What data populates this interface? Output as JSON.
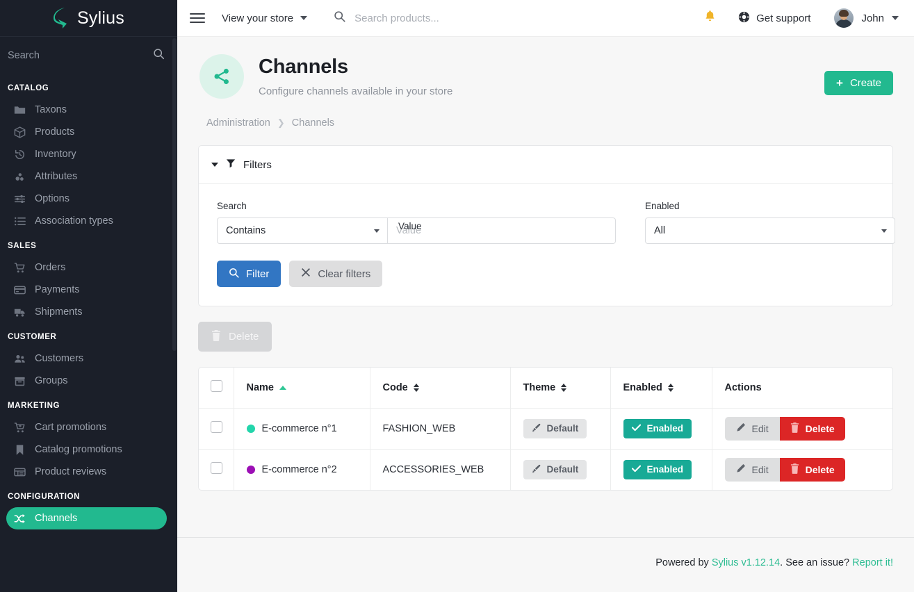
{
  "brand": {
    "name": "Sylius",
    "logo_icon": "sylius-logo-icon"
  },
  "sidebar": {
    "search_placeholder": "Search",
    "search_icon": "search-icon",
    "sections": [
      {
        "title": "CATALOG",
        "items": [
          {
            "label": "Taxons",
            "icon": "folder-icon",
            "active": false
          },
          {
            "label": "Products",
            "icon": "box-icon",
            "active": false
          },
          {
            "label": "Inventory",
            "icon": "history-icon",
            "active": false
          },
          {
            "label": "Attributes",
            "icon": "molecule-icon",
            "active": false
          },
          {
            "label": "Options",
            "icon": "sliders-icon",
            "active": false
          },
          {
            "label": "Association types",
            "icon": "list-icon",
            "active": false
          }
        ]
      },
      {
        "title": "SALES",
        "items": [
          {
            "label": "Orders",
            "icon": "cart-icon",
            "active": false
          },
          {
            "label": "Payments",
            "icon": "credit-card-icon",
            "active": false
          },
          {
            "label": "Shipments",
            "icon": "truck-icon",
            "active": false
          }
        ]
      },
      {
        "title": "CUSTOMER",
        "items": [
          {
            "label": "Customers",
            "icon": "users-icon",
            "active": false
          },
          {
            "label": "Groups",
            "icon": "archive-icon",
            "active": false
          }
        ]
      },
      {
        "title": "MARKETING",
        "items": [
          {
            "label": "Cart promotions",
            "icon": "cart-plus-icon",
            "active": false
          },
          {
            "label": "Catalog promotions",
            "icon": "bookmark-icon",
            "active": false
          },
          {
            "label": "Product reviews",
            "icon": "table-icon",
            "active": false
          }
        ]
      },
      {
        "title": "CONFIGURATION",
        "items": [
          {
            "label": "Channels",
            "icon": "shuffle-icon",
            "active": true
          }
        ]
      }
    ]
  },
  "topbar": {
    "menu_icon": "hamburger-icon",
    "view_store_label": "View your store",
    "view_store_caret_icon": "chevron-down-icon",
    "search_icon": "search-icon",
    "search_placeholder": "Search products...",
    "notifications_icon": "bell-icon",
    "support_icon": "lifebuoy-icon",
    "support_label": "Get support",
    "avatar_icon": "user-avatar",
    "user_name": "John",
    "user_caret_icon": "chevron-down-icon"
  },
  "page": {
    "header_icon": "share-nodes-icon",
    "title": "Channels",
    "subtitle": "Configure channels available in your store",
    "create_label": "Create",
    "create_icon": "plus-icon",
    "breadcrumb": [
      {
        "label": "Administration",
        "link": true
      },
      {
        "label": "Channels",
        "link": false
      }
    ],
    "breadcrumb_sep_icon": "chevron-right-icon"
  },
  "filters": {
    "caret_icon": "caret-down-icon",
    "funnel_icon": "filter-icon",
    "title": "Filters",
    "search": {
      "label": "Search",
      "selected": "Contains",
      "caret_icon": "caret-down-icon"
    },
    "value": {
      "label": "Value",
      "value": "",
      "placeholder": "Value"
    },
    "enabled": {
      "label": "Enabled",
      "selected": "All",
      "caret_icon": "caret-down-icon"
    },
    "filter_button": {
      "label": "Filter",
      "icon": "search-icon"
    },
    "clear_button": {
      "label": "Clear filters",
      "icon": "times-icon"
    }
  },
  "bulk": {
    "delete_label": "Delete",
    "delete_icon": "trash-icon",
    "disabled": true
  },
  "table": {
    "select_all_icon": "checkbox-unchecked",
    "columns": [
      {
        "label": "Name",
        "sort": "asc",
        "sort_icon": "sort-asc-icon"
      },
      {
        "label": "Code",
        "sort": "none",
        "sort_icon": "sort-both-icon"
      },
      {
        "label": "Theme",
        "sort": "none",
        "sort_icon": "sort-both-icon"
      },
      {
        "label": "Enabled",
        "sort": "none",
        "sort_icon": "sort-both-icon"
      },
      {
        "label": "Actions",
        "sort": null,
        "sort_icon": null
      }
    ],
    "rows": [
      {
        "checkbox_icon": "checkbox-unchecked",
        "color": "#23d5ab",
        "name": "E-commerce n°1",
        "code": "FASHION_WEB",
        "theme": "Default",
        "theme_icon": "paint-brush-icon",
        "enabled": "Enabled",
        "enabled_icon": "check-icon",
        "edit_label": "Edit",
        "edit_icon": "pencil-icon",
        "delete_label": "Delete",
        "delete_icon": "trash-icon"
      },
      {
        "checkbox_icon": "checkbox-unchecked",
        "color": "#9c0fb5",
        "name": "E-commerce n°2",
        "code": "ACCESSORIES_WEB",
        "theme": "Default",
        "theme_icon": "paint-brush-icon",
        "enabled": "Enabled",
        "enabled_icon": "check-icon",
        "edit_label": "Edit",
        "edit_icon": "pencil-icon",
        "delete_label": "Delete",
        "delete_icon": "trash-icon"
      }
    ]
  },
  "footer": {
    "prefix": "Powered by ",
    "sylius_link": "Sylius v1.12.14",
    "middle": ". See an issue? ",
    "report_link": "Report it!"
  },
  "colors": {
    "sidebar_bg": "#1b1f29",
    "accent_green": "#22b98f",
    "primary_blue": "#3276c3",
    "danger_red": "#dc2626",
    "badge_green": "#18aa96",
    "page_bg": "#f7f7f7"
  }
}
